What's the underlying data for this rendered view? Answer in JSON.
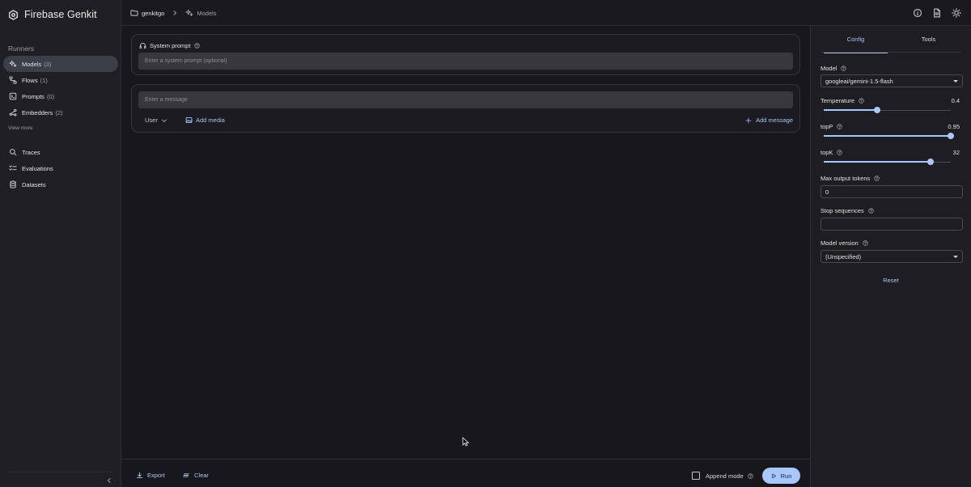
{
  "app": {
    "title": "Firebase Genkit",
    "brand_icon": "hexagon-logo-icon"
  },
  "sidebar": {
    "section_label": "Runners",
    "runners": [
      {
        "label": "Models",
        "count": "(3)",
        "icon": "sparkle-icon",
        "active": true
      },
      {
        "label": "Flows",
        "count": "(1)",
        "icon": "flow-icon",
        "active": false
      },
      {
        "label": "Prompts",
        "count": "(0)",
        "icon": "prompt-icon",
        "active": false
      },
      {
        "label": "Embedders",
        "count": "(2)",
        "icon": "embedder-icon",
        "active": false
      }
    ],
    "view_more": "View more",
    "tools": [
      {
        "label": "Traces",
        "icon": "search-icon"
      },
      {
        "label": "Evaluations",
        "icon": "checklist-icon"
      },
      {
        "label": "Datasets",
        "icon": "database-icon"
      }
    ]
  },
  "topbar": {
    "breadcrumb": [
      "genkitgo",
      "Models"
    ]
  },
  "main": {
    "system_prompt_label": "System prompt",
    "system_prompt_placeholder": "Enter a system prompt (optional)",
    "message_placeholder": "Enter a message",
    "role": "User",
    "add_media": "Add media",
    "add_message": "Add message"
  },
  "bottombar": {
    "export": "Export",
    "clear": "Clear",
    "append_mode": "Append mode",
    "run": "Run"
  },
  "config": {
    "tabs": [
      "Config",
      "Tools"
    ],
    "active_tab": "Config",
    "model_label": "Model",
    "model_value": "googleai/gemini-1.5-flash",
    "temperature": {
      "label": "Temperature",
      "value": "0.4",
      "fraction": 0.42
    },
    "topP": {
      "label": "topP",
      "value": "0.95",
      "fraction": 1.0
    },
    "topK": {
      "label": "topK",
      "value": "32",
      "fraction": 0.84
    },
    "max_tokens_label": "Max output tokens",
    "max_tokens_value": "0",
    "stop_sequences_label": "Stop sequences",
    "stop_sequences_value": "",
    "model_version_label": "Model version",
    "model_version_value": "(Unspecified)",
    "reset": "Reset"
  },
  "colors": {
    "accent": "#a8c7fa",
    "background": "#1a1a1e",
    "sidebar": "#202024",
    "active_nav": "#3b3f4a"
  }
}
